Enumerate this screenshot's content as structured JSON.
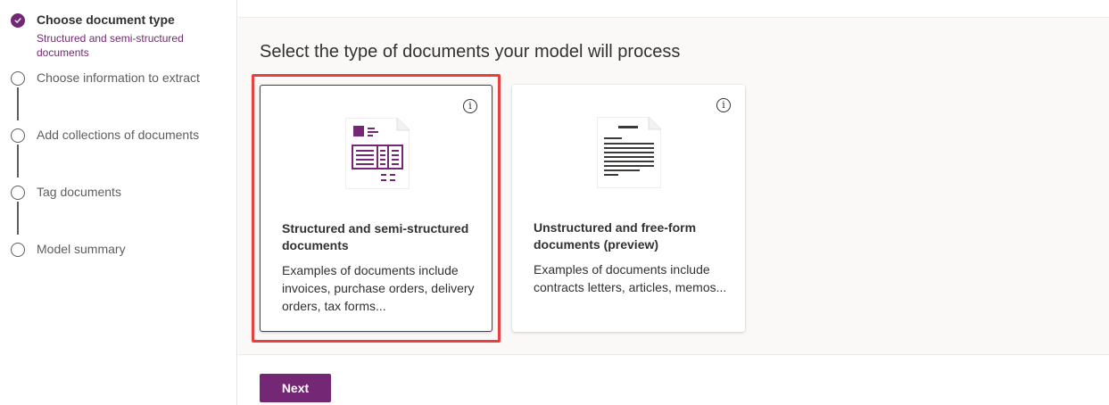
{
  "steps": [
    {
      "label": "Choose document type",
      "sublabel": "Structured and semi-structured documents",
      "state": "done"
    },
    {
      "label": "Choose information to extract",
      "state": "pending"
    },
    {
      "label": "Add collections of documents",
      "state": "pending"
    },
    {
      "label": "Tag documents",
      "state": "pending"
    },
    {
      "label": "Model summary",
      "state": "pending"
    }
  ],
  "main": {
    "heading": "Select the type of documents your model will process",
    "cards": [
      {
        "title": "Structured and semi-structured documents",
        "description": "Examples of documents include invoices, purchase orders, delivery orders, tax forms...",
        "icon": "structured-document-icon",
        "selected": true
      },
      {
        "title": "Unstructured and free-form documents (preview)",
        "description": "Examples of documents include contracts letters, articles, memos...",
        "icon": "unstructured-document-icon",
        "selected": false
      }
    ],
    "info_glyph": "i"
  },
  "footer": {
    "next_label": "Next"
  },
  "colors": {
    "accent": "#742774",
    "highlight": "#e8403f",
    "content_bg": "#faf9f8"
  }
}
